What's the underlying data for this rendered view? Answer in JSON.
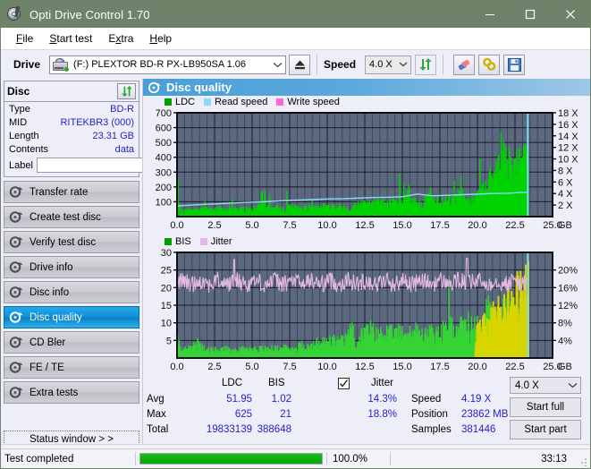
{
  "window": {
    "title": "Opti Drive Control 1.70",
    "icon": "optical-disc-icon",
    "minimize": "minimize-icon",
    "maximize": "maximize-icon",
    "close": "close-icon"
  },
  "menubar": {
    "items": [
      {
        "label": "File",
        "accel": "F"
      },
      {
        "label": "Start test",
        "accel": "S"
      },
      {
        "label": "Extra",
        "accel": "x"
      },
      {
        "label": "Help",
        "accel": "H"
      }
    ]
  },
  "toolbar": {
    "drive_label": "Drive",
    "drive_value": "(F:)  PLEXTOR BD-R  PX-LB950SA 1.06",
    "eject_icon": "eject-icon",
    "speed_label": "Speed",
    "speed_value": "4.0 X",
    "refresh_icon": "refresh-icon",
    "eraser_icon": "eraser-icon",
    "settings_icon": "settings-icon",
    "save_icon": "save-icon"
  },
  "disc_panel": {
    "title": "Disc",
    "refresh_icon": "refresh-icon",
    "rows": [
      {
        "key": "Type",
        "value": "BD-R"
      },
      {
        "key": "MID",
        "value": "RITEKBR3 (000)"
      },
      {
        "key": "Length",
        "value": "23.31 GB"
      },
      {
        "key": "Contents",
        "value": "data"
      }
    ],
    "label_key": "Label",
    "label_value": "",
    "label_icon": "disc-icon"
  },
  "sidebar": {
    "items": [
      {
        "label": "Transfer rate",
        "icon": "disc-test-icon",
        "active": false
      },
      {
        "label": "Create test disc",
        "icon": "disc-burn-icon",
        "active": false
      },
      {
        "label": "Verify test disc",
        "icon": "disc-verify-icon",
        "active": false
      },
      {
        "label": "Drive info",
        "icon": "disc-drive-icon",
        "active": false
      },
      {
        "label": "Disc info",
        "icon": "disc-info-icon",
        "active": false
      },
      {
        "label": "Disc quality",
        "icon": "disc-quality-icon",
        "active": true
      },
      {
        "label": "CD Bler",
        "icon": "disc-bler-icon",
        "active": false
      },
      {
        "label": "FE / TE",
        "icon": "disc-fete-icon",
        "active": false
      },
      {
        "label": "Extra tests",
        "icon": "disc-extra-icon",
        "active": false
      }
    ],
    "status_window": "Status window > >"
  },
  "main": {
    "header_title": "Disc quality",
    "header_icon": "disc-quality-icon"
  },
  "stats": {
    "col_headers": [
      "LDC",
      "BIS"
    ],
    "row_headers": [
      "Avg",
      "Max",
      "Total"
    ],
    "ldc": {
      "avg": "51.95",
      "max": "625",
      "total": "19833139"
    },
    "bis": {
      "avg": "1.02",
      "max": "21",
      "total": "388648"
    },
    "jitter_label": "Jitter",
    "jitter_checked": true,
    "jitter_avg": "14.3%",
    "jitter_max": "18.8%",
    "speed_label": "Speed",
    "speed_value": "4.19 X",
    "position_label": "Position",
    "position_value": "23862 MB",
    "samples_label": "Samples",
    "samples_value": "381446",
    "speed_select": "4.0 X",
    "start_full": "Start full",
    "start_part": "Start part"
  },
  "statusbar": {
    "message": "Test completed",
    "percent": "100.0%",
    "percent_value": 100,
    "elapsed": "33:13",
    "grip_icon": "resize-grip-icon"
  },
  "colors": {
    "titlebar": "#6e8369",
    "accent": "#4a9fd8",
    "ldc_green": "#00d400",
    "bis_green": "#23c523",
    "jitter_pink": "#e3b7e0",
    "read_speed_blue": "#8fd8f5",
    "write_speed_pink": "#ff66dd",
    "plot_bg": "#5a6880",
    "value_blue": "#2222cc",
    "progress_green": "#06a406"
  },
  "chart_data": [
    {
      "type": "area",
      "name": "ldc-chart",
      "title": "",
      "xlabel": "GB",
      "ylabel": "",
      "xlim": [
        0.0,
        25.0
      ],
      "xticks": [
        "0.0",
        "2.5",
        "5.0",
        "7.5",
        "10.0",
        "12.5",
        "15.0",
        "17.5",
        "20.0",
        "22.5",
        "25.0"
      ],
      "ylim": [
        0,
        700
      ],
      "yticks": [
        100,
        200,
        300,
        400,
        500,
        600,
        700
      ],
      "y2lim": [
        0,
        18
      ],
      "y2ticks": [
        "2 X",
        "4 X",
        "6 X",
        "8 X",
        "10 X",
        "12 X",
        "14 X",
        "16 X",
        "18 X"
      ],
      "grid": true,
      "legend": [
        {
          "name": "LDC",
          "color": "#00a000"
        },
        {
          "name": "Read speed",
          "color": "#8fd8f5"
        },
        {
          "name": "Write speed",
          "color": "#ff66dd"
        }
      ],
      "legend_position": "top-left",
      "series": [
        {
          "name": "LDC",
          "type": "area",
          "color": "#00d400",
          "x": [
            0.0,
            0.2,
            0.5,
            0.9,
            1.3,
            1.8,
            2.3,
            2.8,
            3.3,
            3.8,
            4.3,
            4.8,
            5.3,
            5.7,
            5.8,
            6.1,
            6.5,
            7.0,
            7.5,
            8.0,
            8.5,
            9.0,
            9.5,
            10.0,
            10.5,
            11.0,
            11.5,
            11.8,
            12.0,
            12.5,
            13.0,
            13.5,
            14.0,
            14.5,
            15.0,
            15.4,
            15.5,
            16.0,
            16.5,
            16.9,
            17.0,
            17.5,
            18.0,
            18.5,
            18.8,
            19.0,
            19.5,
            20.0,
            20.3,
            20.6,
            21.0,
            21.4,
            21.6,
            21.9,
            22.1,
            22.3,
            22.5,
            22.8,
            23.1,
            23.3
          ],
          "y": [
            130,
            45,
            55,
            60,
            58,
            62,
            60,
            65,
            62,
            68,
            65,
            70,
            68,
            200,
            72,
            70,
            75,
            72,
            78,
            75,
            80,
            78,
            85,
            82,
            88,
            85,
            60,
            95,
            105,
            110,
            108,
            115,
            112,
            118,
            120,
            200,
            122,
            125,
            128,
            200,
            130,
            135,
            140,
            145,
            300,
            150,
            160,
            180,
            230,
            280,
            330,
            380,
            620,
            400,
            440,
            420,
            460,
            430,
            470,
            490
          ]
        },
        {
          "name": "Read speed",
          "type": "line",
          "color": "#8fd8f5",
          "x": [
            0.0,
            1.0,
            2.0,
            3.0,
            4.0,
            5.0,
            6.0,
            7.0,
            8.0,
            9.0,
            10.0,
            11.0,
            12.0,
            13.0,
            14.0,
            15.0,
            16.0,
            17.0,
            18.0,
            19.0,
            20.0,
            21.0,
            22.0,
            23.0,
            23.35,
            23.35
          ],
          "y": [
            1.85,
            2.0,
            2.15,
            2.25,
            2.4,
            2.5,
            2.6,
            2.75,
            2.85,
            2.95,
            3.05,
            3.1,
            3.2,
            3.3,
            3.35,
            3.45,
            3.9,
            3.6,
            3.7,
            3.8,
            3.9,
            4.0,
            4.05,
            4.2,
            4.2,
            18.0
          ]
        }
      ]
    },
    {
      "type": "area",
      "name": "bis-jitter-chart",
      "title": "",
      "xlabel": "GB",
      "ylabel": "",
      "xlim": [
        0.0,
        25.0
      ],
      "xticks": [
        "0.0",
        "2.5",
        "5.0",
        "7.5",
        "10.0",
        "12.5",
        "15.0",
        "17.5",
        "20.0",
        "22.5",
        "25.0"
      ],
      "ylim": [
        0,
        30
      ],
      "yticks": [
        5,
        10,
        15,
        20,
        25,
        30
      ],
      "y2lim": [
        0,
        20
      ],
      "y2ticks": [
        "4%",
        "8%",
        "12%",
        "16%",
        "20%"
      ],
      "grid": true,
      "legend": [
        {
          "name": "BIS",
          "color": "#00a000"
        },
        {
          "name": "Jitter",
          "color": "#e3b7e0"
        }
      ],
      "legend_position": "top-left",
      "series": [
        {
          "name": "BIS",
          "type": "area",
          "color": "#35d435",
          "x": [
            0.0,
            0.3,
            0.8,
            1.3,
            1.8,
            2.3,
            2.8,
            3.3,
            3.8,
            4.3,
            4.8,
            5.3,
            5.8,
            6.3,
            6.8,
            7.3,
            7.8,
            8.3,
            8.8,
            9.3,
            9.8,
            10.3,
            10.8,
            11.3,
            11.6,
            11.9,
            12.3,
            12.8,
            13.3,
            13.8,
            14.3,
            14.8,
            15.3,
            15.8,
            16.3,
            16.8,
            17.3,
            17.8,
            18.3,
            18.8,
            19.3,
            19.6,
            19.9,
            20.2,
            20.5,
            20.8,
            21.1,
            21.4,
            21.7,
            22.0,
            22.3,
            22.6,
            22.9,
            23.2,
            23.35
          ],
          "y": [
            7.0,
            3.0,
            3.2,
            5.5,
            3.0,
            3.2,
            3.0,
            3.4,
            3.1,
            3.3,
            3.2,
            3.4,
            3.3,
            3.5,
            3.3,
            3.6,
            3.4,
            4.8,
            3.8,
            5.5,
            5.8,
            6.5,
            6.0,
            6.8,
            11.0,
            4.5,
            8.5,
            10.5,
            8.0,
            9.5,
            8.5,
            9.0,
            8.5,
            9.5,
            8.0,
            9.0,
            8.5,
            10.0,
            11.0,
            10.5,
            12.5,
            11.0,
            13.0,
            14.0,
            15.5,
            17.5,
            16.0,
            17.0,
            15.5,
            17.0,
            16.5,
            18.0,
            16.5,
            17.5,
            16.0
          ]
        },
        {
          "name": "Jitter",
          "type": "line",
          "color": "#e3b7e0",
          "mean": 21.5,
          "amplitude": 2.5,
          "description": "Noisy line oscillating roughly between 19 and 25 across entire disc, peak ~28 near 3.8 GB and ~28.5 near 19.3 GB"
        }
      ]
    }
  ]
}
